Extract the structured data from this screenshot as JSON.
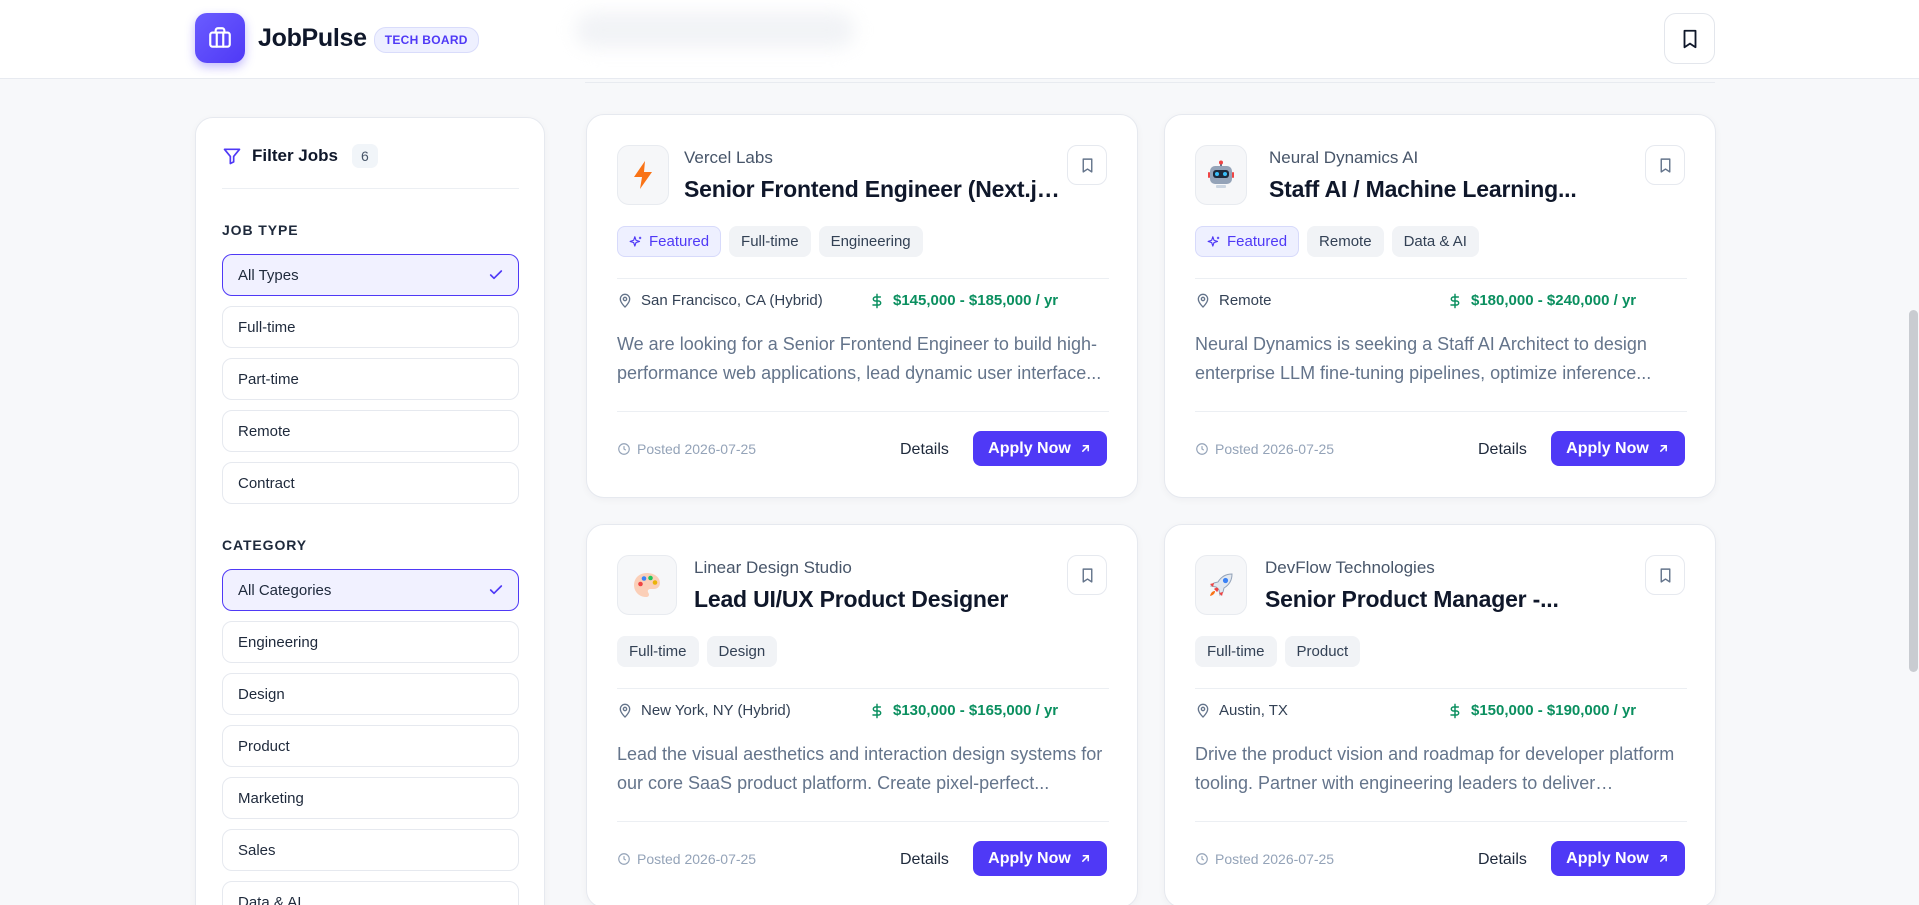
{
  "header": {
    "brand_name": "JobPulse",
    "brand_badge": "TECH BOARD"
  },
  "sidebar": {
    "title": "Filter Jobs",
    "count": "6",
    "job_type": {
      "label": "JOB TYPE",
      "options": [
        "All Types",
        "Full-time",
        "Part-time",
        "Remote",
        "Contract"
      ],
      "selected": "All Types"
    },
    "category": {
      "label": "CATEGORY",
      "options": [
        "All Categories",
        "Engineering",
        "Design",
        "Product",
        "Marketing",
        "Sales",
        "Data & AI"
      ],
      "selected": "All Categories"
    }
  },
  "jobs": [
    {
      "company": "Vercel Labs",
      "title": "Senior Frontend Engineer (Next.js...",
      "logo_icon": "bolt-icon",
      "tags": [
        "Featured",
        "Full-time",
        "Engineering"
      ],
      "location": "San Francisco, CA (Hybrid)",
      "salary": "$145,000 - $185,000 / yr",
      "description": "We are looking for a Senior Frontend Engineer to build high-performance web applications, lead dynamic user interface...",
      "posted": "Posted 2026-07-25",
      "details_label": "Details",
      "apply_label": "Apply Now"
    },
    {
      "company": "Neural Dynamics AI",
      "title": "Staff AI / Machine Learning...",
      "logo_icon": "robot-icon",
      "tags": [
        "Featured",
        "Remote",
        "Data & AI"
      ],
      "location": "Remote",
      "salary": "$180,000 - $240,000 / yr",
      "description": "Neural Dynamics is seeking a Staff AI Architect to design enterprise LLM fine-tuning pipelines, optimize inference...",
      "posted": "Posted 2026-07-25",
      "details_label": "Details",
      "apply_label": "Apply Now"
    },
    {
      "company": "Linear Design Studio",
      "title": "Lead UI/UX Product Designer",
      "logo_icon": "palette-icon",
      "tags": [
        "Full-time",
        "Design"
      ],
      "location": "New York, NY (Hybrid)",
      "salary": "$130,000 - $165,000 / yr",
      "description": "Lead the visual aesthetics and interaction design systems for our core SaaS product platform. Create pixel-perfect...",
      "posted": "Posted 2026-07-25",
      "details_label": "Details",
      "apply_label": "Apply Now"
    },
    {
      "company": "DevFlow Technologies",
      "title": "Senior Product Manager -...",
      "logo_icon": "rocket-icon",
      "tags": [
        "Full-time",
        "Product"
      ],
      "location": "Austin, TX",
      "salary": "$150,000 - $190,000 / yr",
      "description": "Drive the product vision and roadmap for developer platform tooling. Partner with engineering leaders to deliver seamless...",
      "posted": "Posted 2026-07-25",
      "details_label": "Details",
      "apply_label": "Apply Now"
    }
  ],
  "colors": {
    "accent": "#4f39f6",
    "salary": "#0a8f5f",
    "background": "#f7f8fa"
  }
}
